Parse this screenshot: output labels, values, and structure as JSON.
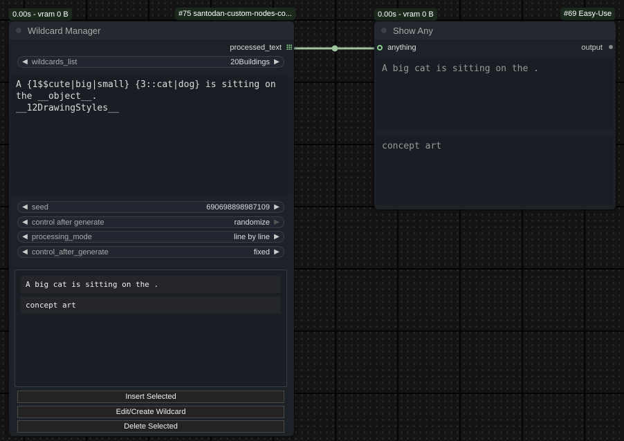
{
  "badges": {
    "left_timing": "0.00s - vram 0 B",
    "left_id": "#75 santodan-custom-nodes-co...",
    "right_timing": "0.00s - vram 0 B",
    "right_id": "#69 Easy-Use"
  },
  "wildcard_node": {
    "title": "Wildcard Manager",
    "output_label": "processed_text",
    "wildcards_list": {
      "label": "wildcards_list",
      "value": "20Buildings"
    },
    "prompt_text": "A {1$$cute|big|small} {3::cat|dog} is sitting on\nthe __object__.\n__12DrawingStyles__",
    "seed": {
      "label": "seed",
      "value": "690698898987109"
    },
    "control_after_generate": {
      "label": "control after generate",
      "value": "randomize"
    },
    "processing_mode": {
      "label": "processing_mode",
      "value": "line by line"
    },
    "control_after_generate_2": {
      "label": "control_after_generate",
      "value": "fixed"
    },
    "list_items": [
      "A big cat is sitting on the .",
      "concept art"
    ],
    "buttons": {
      "insert": "Insert Selected",
      "edit": "Edit/Create Wildcard",
      "delete": "Delete Selected"
    }
  },
  "show_any_node": {
    "title": "Show Any",
    "input_label": "anything",
    "output_label": "output",
    "text_1": "A big cat is sitting on the .",
    "text_2": "concept art"
  },
  "colors": {
    "link": "#9fc49f",
    "input_slot": "#8fd18f",
    "canvas": "#141414",
    "node_bg": "#1d2128"
  }
}
